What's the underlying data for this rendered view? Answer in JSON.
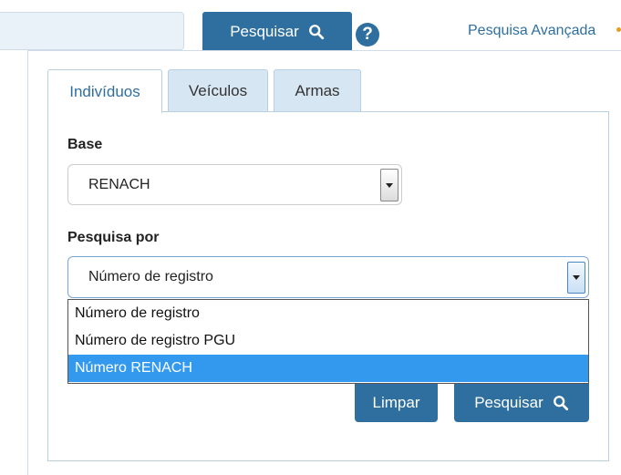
{
  "header": {
    "search_button_label": "Pesquisar",
    "help_symbol": "?",
    "advanced_search_label": "Pesquisa Avançada"
  },
  "tabs": [
    {
      "label": "Indivíduos",
      "active": true
    },
    {
      "label": "Veículos",
      "active": false
    },
    {
      "label": "Armas",
      "active": false
    }
  ],
  "form": {
    "base_label": "Base",
    "base_value": "RENACH",
    "pesquisa_label": "Pesquisa por",
    "pesquisa_value": "Número de registro",
    "pesquisa_options": [
      {
        "label": "Número de registro",
        "highlighted": false
      },
      {
        "label": "Número de registro PGU",
        "highlighted": false
      },
      {
        "label": "Número RENACH",
        "highlighted": true
      }
    ]
  },
  "actions": {
    "clear_label": "Limpar",
    "search_label": "Pesquisar"
  },
  "colors": {
    "primary": "#2f6f9f",
    "tab_inactive_bg": "#d7e6f3",
    "option_highlight": "#3399ee"
  },
  "icons": {
    "search": "search-icon",
    "help": "question-circle-icon",
    "select_arrow": "chevron-down-icon"
  }
}
